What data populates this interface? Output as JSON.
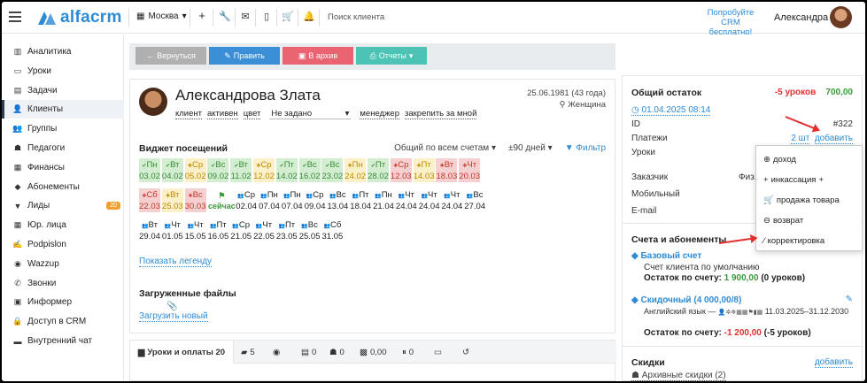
{
  "app": {
    "logo": "alfacrm",
    "city": "Москва",
    "search_placeholder": "Поиск клиента",
    "promo": "Попробуйте CRM бесплатно!",
    "user": "Александра"
  },
  "sidebar": {
    "items": [
      {
        "label": "Аналитика",
        "icon": "analytics-icon"
      },
      {
        "label": "Уроки",
        "icon": "monitor-icon"
      },
      {
        "label": "Задачи",
        "icon": "clipboard-icon"
      },
      {
        "label": "Клиенты",
        "icon": "user-icon"
      },
      {
        "label": "Группы",
        "icon": "group-icon"
      },
      {
        "label": "Педагоги",
        "icon": "teacher-icon"
      },
      {
        "label": "Финансы",
        "icon": "finance-icon"
      },
      {
        "label": "Абонементы",
        "icon": "tag-icon"
      },
      {
        "label": "Лиды",
        "icon": "funnel-icon",
        "badge": "20"
      },
      {
        "label": "Юр. лица",
        "icon": "building-icon"
      },
      {
        "label": "Podpislon",
        "icon": "signature-icon"
      },
      {
        "label": "Wazzup",
        "icon": "chat-icon"
      },
      {
        "label": "Звонки",
        "icon": "phone-icon"
      },
      {
        "label": "Информер",
        "icon": "inbox-icon"
      },
      {
        "label": "Доступ в CRM",
        "icon": "lock-icon"
      },
      {
        "label": "Внутренний чат",
        "icon": "message-icon"
      }
    ]
  },
  "actions": {
    "back": "Вернуться",
    "edit": "Править",
    "archive": "В архив",
    "reports": "Отчеты"
  },
  "client": {
    "name": "Александрова Злата",
    "dob": "25.06.1981 (43 года)",
    "gender": "Женщина",
    "tag_client": "клиент",
    "tag_active": "активен",
    "tag_color": "цвет",
    "status_value": "Не задано",
    "tag_manager": "менеджер",
    "assign_me": "закрепить за мной"
  },
  "widget": {
    "title": "Виджет посещений",
    "filter_account": "Общий по всем счетам",
    "filter_days": "±90 дней",
    "filter_btn": "Фильтр",
    "legend_link": "Показать легенду",
    "now_label": "сейчас"
  },
  "days": [
    {
      "d": "Пн",
      "date": "03.02",
      "s": "g"
    },
    {
      "d": "Вт",
      "date": "04.02",
      "s": "g"
    },
    {
      "d": "Ср",
      "date": "05.02",
      "s": "y"
    },
    {
      "d": "Вс",
      "date": "09.02",
      "s": "g"
    },
    {
      "d": "Вт",
      "date": "11.02",
      "s": "g"
    },
    {
      "d": "Ср",
      "date": "12.02",
      "s": "y"
    },
    {
      "d": "Пт",
      "date": "14.02",
      "s": "g"
    },
    {
      "d": "Вс",
      "date": "16.02",
      "s": "g"
    },
    {
      "d": "Вс",
      "date": "23.02",
      "s": "g"
    },
    {
      "d": "Пн",
      "date": "24.02",
      "s": "y"
    },
    {
      "d": "Пт",
      "date": "28.02",
      "s": "g"
    },
    {
      "d": "Ср",
      "date": "12.03",
      "s": "r"
    },
    {
      "d": "Пт",
      "date": "14.03",
      "s": "y"
    },
    {
      "d": "Вт",
      "date": "18.03",
      "s": "r"
    },
    {
      "d": "Чт",
      "date": "20.03",
      "s": "r"
    },
    {
      "d": "Сб",
      "date": "22.03",
      "s": "r"
    },
    {
      "d": "Вт",
      "date": "25.03",
      "s": "y"
    },
    {
      "d": "Вс",
      "date": "30.03",
      "s": "r"
    },
    {
      "d": "",
      "date": "",
      "s": "now"
    },
    {
      "d": "Ср",
      "date": "02.04",
      "s": "n"
    },
    {
      "d": "Пн",
      "date": "07.04",
      "s": "n"
    },
    {
      "d": "Пн",
      "date": "07.04",
      "s": "n"
    },
    {
      "d": "Ср",
      "date": "09.04",
      "s": "n"
    },
    {
      "d": "Вс",
      "date": "13.04",
      "s": "n"
    },
    {
      "d": "Пт",
      "date": "18.04",
      "s": "n"
    },
    {
      "d": "Пн",
      "date": "21.04",
      "s": "n"
    },
    {
      "d": "Чт",
      "date": "24.04",
      "s": "n"
    },
    {
      "d": "Чт",
      "date": "24.04",
      "s": "n"
    },
    {
      "d": "Чт",
      "date": "24.04",
      "s": "n"
    },
    {
      "d": "Вс",
      "date": "27.04",
      "s": "n"
    },
    {
      "d": "Вт",
      "date": "29.04",
      "s": "n"
    },
    {
      "d": "Чт",
      "date": "01.05",
      "s": "n"
    },
    {
      "d": "Чт",
      "date": "15.05",
      "s": "n"
    },
    {
      "d": "Пт",
      "date": "16.05",
      "s": "n"
    },
    {
      "d": "Ср",
      "date": "21.05",
      "s": "n"
    },
    {
      "d": "Чт",
      "date": "22.05",
      "s": "n"
    },
    {
      "d": "Пт",
      "date": "23.05",
      "s": "n"
    },
    {
      "d": "Вс",
      "date": "25.05",
      "s": "n"
    },
    {
      "d": "Сб",
      "date": "31.05",
      "s": "n"
    }
  ],
  "files": {
    "title": "Загруженные файлы",
    "upload": "Загрузить новый"
  },
  "tabs": [
    {
      "label": "Уроки и оплаты 20",
      "icon": "book-icon"
    },
    {
      "label": "5",
      "icon": "comments-icon"
    },
    {
      "label": "",
      "icon": "whatsapp-icon"
    },
    {
      "label": "0",
      "icon": "doc-icon"
    },
    {
      "label": "0",
      "icon": "teacher-icon"
    },
    {
      "label": "0,00",
      "icon": "gift-icon"
    },
    {
      "label": "0",
      "icon": "pause-icon"
    },
    {
      "label": "",
      "icon": "money-icon"
    },
    {
      "label": "",
      "icon": "history-icon"
    }
  ],
  "balance": {
    "title": "Общий остаток",
    "lessons": "-5 уроков",
    "amount": "700,00",
    "date": "01.04.2025 08:14",
    "id_label": "ID",
    "id_value": "#322",
    "payments_label": "Платежи",
    "payments_count": "2 шт",
    "add": "добавить",
    "lessons_label": "Уроки",
    "customer_label": "Заказчик",
    "customer_value": "Физ.",
    "mobile_label": "Мобильный",
    "email_label": "E-mail"
  },
  "dropdown": [
    "доход",
    "инкассация",
    "продажа товара",
    "возврат",
    "корректировка"
  ],
  "accounts": {
    "title": "Счета и абонементы",
    "base_title": "Базовый счет",
    "base_desc": "Счет клиента по умолчанию",
    "balance_label": "Остаток по счету:",
    "base_balance": "1 900,00",
    "base_lessons": "(0 уроков)",
    "disc_title": "Скидочный (4 000,00/8)",
    "disc_desc": "Английский язык —",
    "disc_period": "11.03.2025–31.12.2030",
    "disc_balance": "-1 200,00",
    "disc_lessons": "(-5 уроков)"
  },
  "discounts": {
    "title": "Скидки",
    "add": "добавить",
    "archive": "Архивные скидки (2)"
  },
  "colors": {
    "accent": "#2d8bd4",
    "edit_btn": "#3a8fd6",
    "archive_btn": "#e96470",
    "reports_btn": "#4dc3b6",
    "back_btn": "#b0b0b0",
    "negative": "#e03030",
    "positive": "#3a9a3a"
  }
}
